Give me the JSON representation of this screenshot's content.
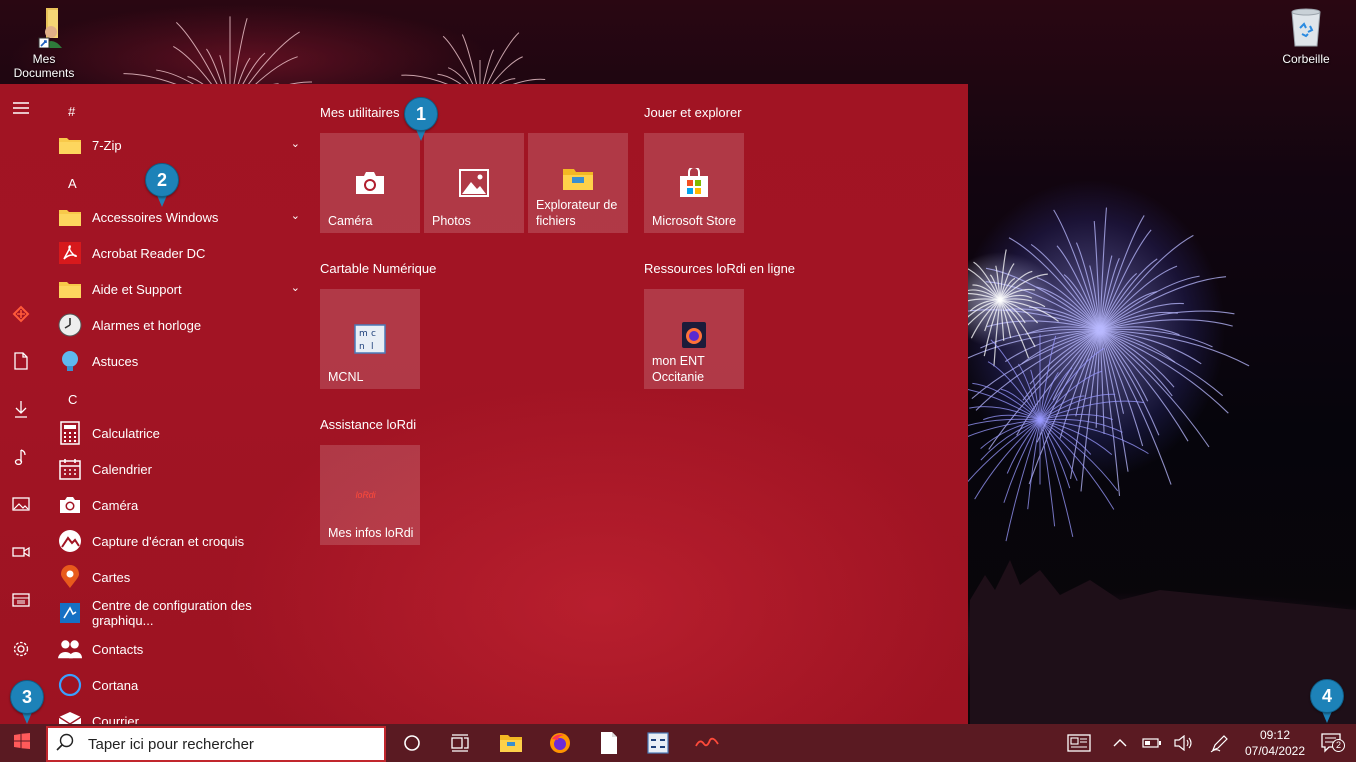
{
  "desktop": {
    "icons": [
      {
        "label": "Mes Documents",
        "icon": "folder-user-shortcut-icon"
      },
      {
        "label": "Corbeille",
        "icon": "recycle-bin-icon"
      }
    ]
  },
  "start_menu": {
    "rail_icons": [
      "hamburger-icon",
      "lordi-icon",
      "document-icon",
      "download-icon",
      "music-icon",
      "pictures-icon",
      "video-icon",
      "file-explorer-icon",
      "gear-icon"
    ],
    "letters": [
      "#",
      "A",
      "C"
    ],
    "apps": [
      {
        "label": "7-Zip",
        "icon": "folder-icon",
        "expandable": true
      },
      {
        "label": "Accessoires Windows",
        "icon": "folder-icon",
        "expandable": true
      },
      {
        "label": "Acrobat Reader DC",
        "icon": "acrobat-icon",
        "expandable": false
      },
      {
        "label": "Aide et Support",
        "icon": "folder-icon",
        "expandable": true
      },
      {
        "label": "Alarmes et horloge",
        "icon": "clock-icon",
        "expandable": false
      },
      {
        "label": "Astuces",
        "icon": "lightbulb-icon",
        "expandable": false
      },
      {
        "label": "Calculatrice",
        "icon": "calculator-icon",
        "expandable": false
      },
      {
        "label": "Calendrier",
        "icon": "calendar-icon",
        "expandable": false
      },
      {
        "label": "Caméra",
        "icon": "camera-icon",
        "expandable": false
      },
      {
        "label": "Capture d'écran et croquis",
        "icon": "snip-icon",
        "expandable": false
      },
      {
        "label": "Cartes",
        "icon": "map-pin-icon",
        "expandable": false
      },
      {
        "label": "Centre de configuration des graphiqu...",
        "icon": "intel-graphics-icon",
        "expandable": false
      },
      {
        "label": "Contacts",
        "icon": "contacts-icon",
        "expandable": false
      },
      {
        "label": "Cortana",
        "icon": "cortana-icon",
        "expandable": false
      },
      {
        "label": "Courrier",
        "icon": "mail-icon",
        "expandable": false
      }
    ],
    "tile_groups": [
      {
        "title": "Mes utilitaires",
        "tiles": [
          "Caméra",
          "Photos",
          "Explorateur de fichiers"
        ]
      },
      {
        "title": "Jouer et explorer",
        "tiles": [
          "Microsoft Store"
        ]
      },
      {
        "title": "Cartable Numérique",
        "tiles": [
          "MCNL"
        ]
      },
      {
        "title": "Ressources loRdi en ligne",
        "tiles": [
          "mon ENT Occitanie"
        ]
      },
      {
        "title": "Assistance loRdi",
        "tiles": [
          "Mes infos loRdi"
        ]
      }
    ],
    "lordi_logo_text": "loRdi"
  },
  "taskbar": {
    "search_placeholder": "Taper ici pour rechercher",
    "time": "09:12",
    "date": "07/04/2022",
    "notification_count": "2"
  },
  "markers": [
    "1",
    "2",
    "3",
    "4"
  ],
  "colors": {
    "start_menu_bg": "#a11423",
    "taskbar_bg": "#5a1a22",
    "marker": "#1d82b8",
    "search_border": "#c1262d"
  }
}
